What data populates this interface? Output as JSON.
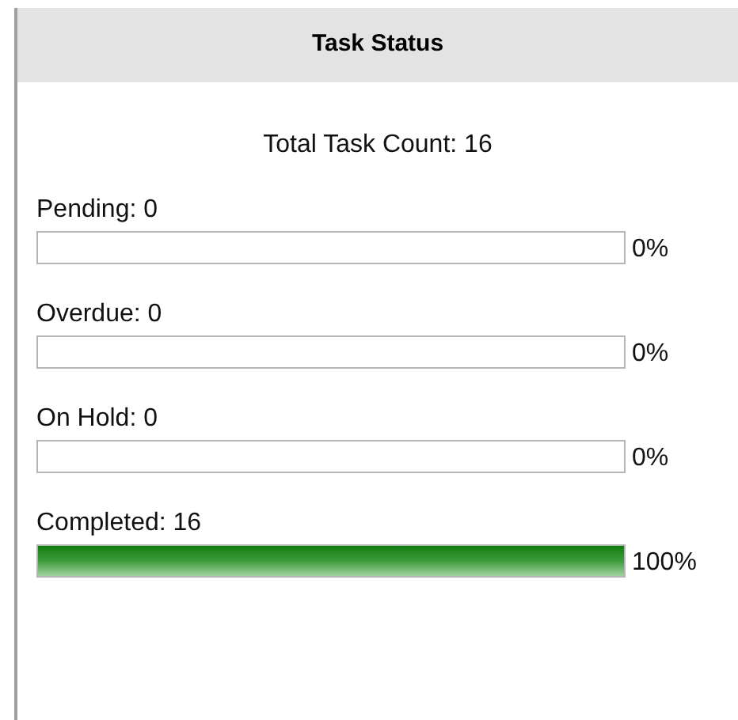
{
  "panel": {
    "title": "Task Status",
    "total": "Total Task Count: 16"
  },
  "statuses": [
    {
      "label": "Pending: 0",
      "level": 0,
      "reading": "0%"
    },
    {
      "label": "Overdue: 0",
      "level": 0,
      "reading": "0%"
    },
    {
      "label": "On Hold: 0",
      "level": 0,
      "reading": "0%"
    },
    {
      "label": "Completed: 16",
      "level": 1,
      "reading": "100%"
    }
  ]
}
